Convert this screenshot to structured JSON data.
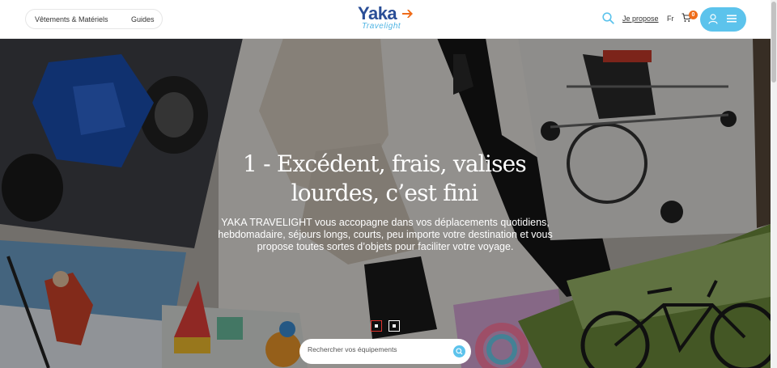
{
  "header": {
    "nav": [
      {
        "label": "Vêtements & Matériels"
      },
      {
        "label": "Guides"
      }
    ],
    "logo": {
      "brand": "Yaka",
      "sub": "Travelight"
    },
    "propose_label": "Je propose",
    "lang_label": "Fr",
    "cart_count": "0"
  },
  "hero": {
    "title_line1": "1 - Excédent, frais, valises",
    "title_line2": "lourdes, c’est fini",
    "desc_line1": "YAKA TRAVELIGHT vous accopagne dans vos déplacements quotidiens,",
    "desc_line2": "hebdomadaire, séjours longs, courts, peu importe votre destination et vous",
    "desc_line3": "propose toutes sortes d’objets pour faciliter votre voyage.",
    "carousel": {
      "slides": 2,
      "active": 1
    }
  },
  "search": {
    "placeholder": "Rechercher vos équipements"
  },
  "colors": {
    "accent": "#5cc3ec",
    "brand_blue": "#2a4e97",
    "brand_orange": "#ef6c1a",
    "active_dot": "#e0342f"
  },
  "icons": [
    "search-icon",
    "cart-icon",
    "user-icon",
    "menu-icon",
    "plane-icon"
  ]
}
